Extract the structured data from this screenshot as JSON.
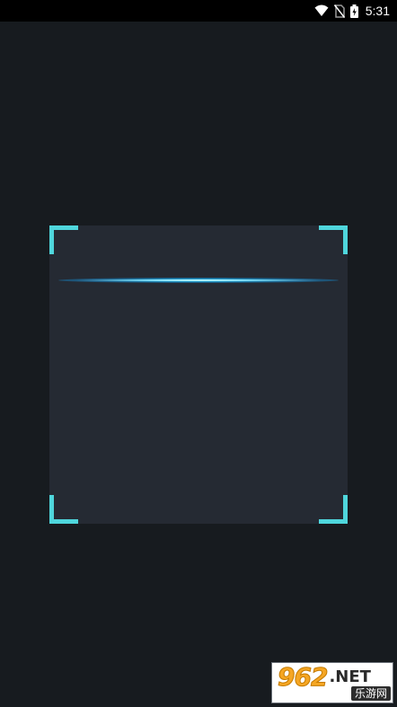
{
  "status_bar": {
    "time": "5:31",
    "icons": [
      "wifi-icon",
      "no-sim-icon",
      "battery-charging-icon"
    ]
  },
  "scanner": {
    "frame_color": "#4fd6dc",
    "scan_line_color": "#28bef0",
    "box_color": "#252a33"
  },
  "watermark": {
    "number": "962",
    "domain": ".NET",
    "site_name": "乐游网"
  },
  "colors": {
    "background": "#171b1f",
    "status_bar": "#000000"
  }
}
